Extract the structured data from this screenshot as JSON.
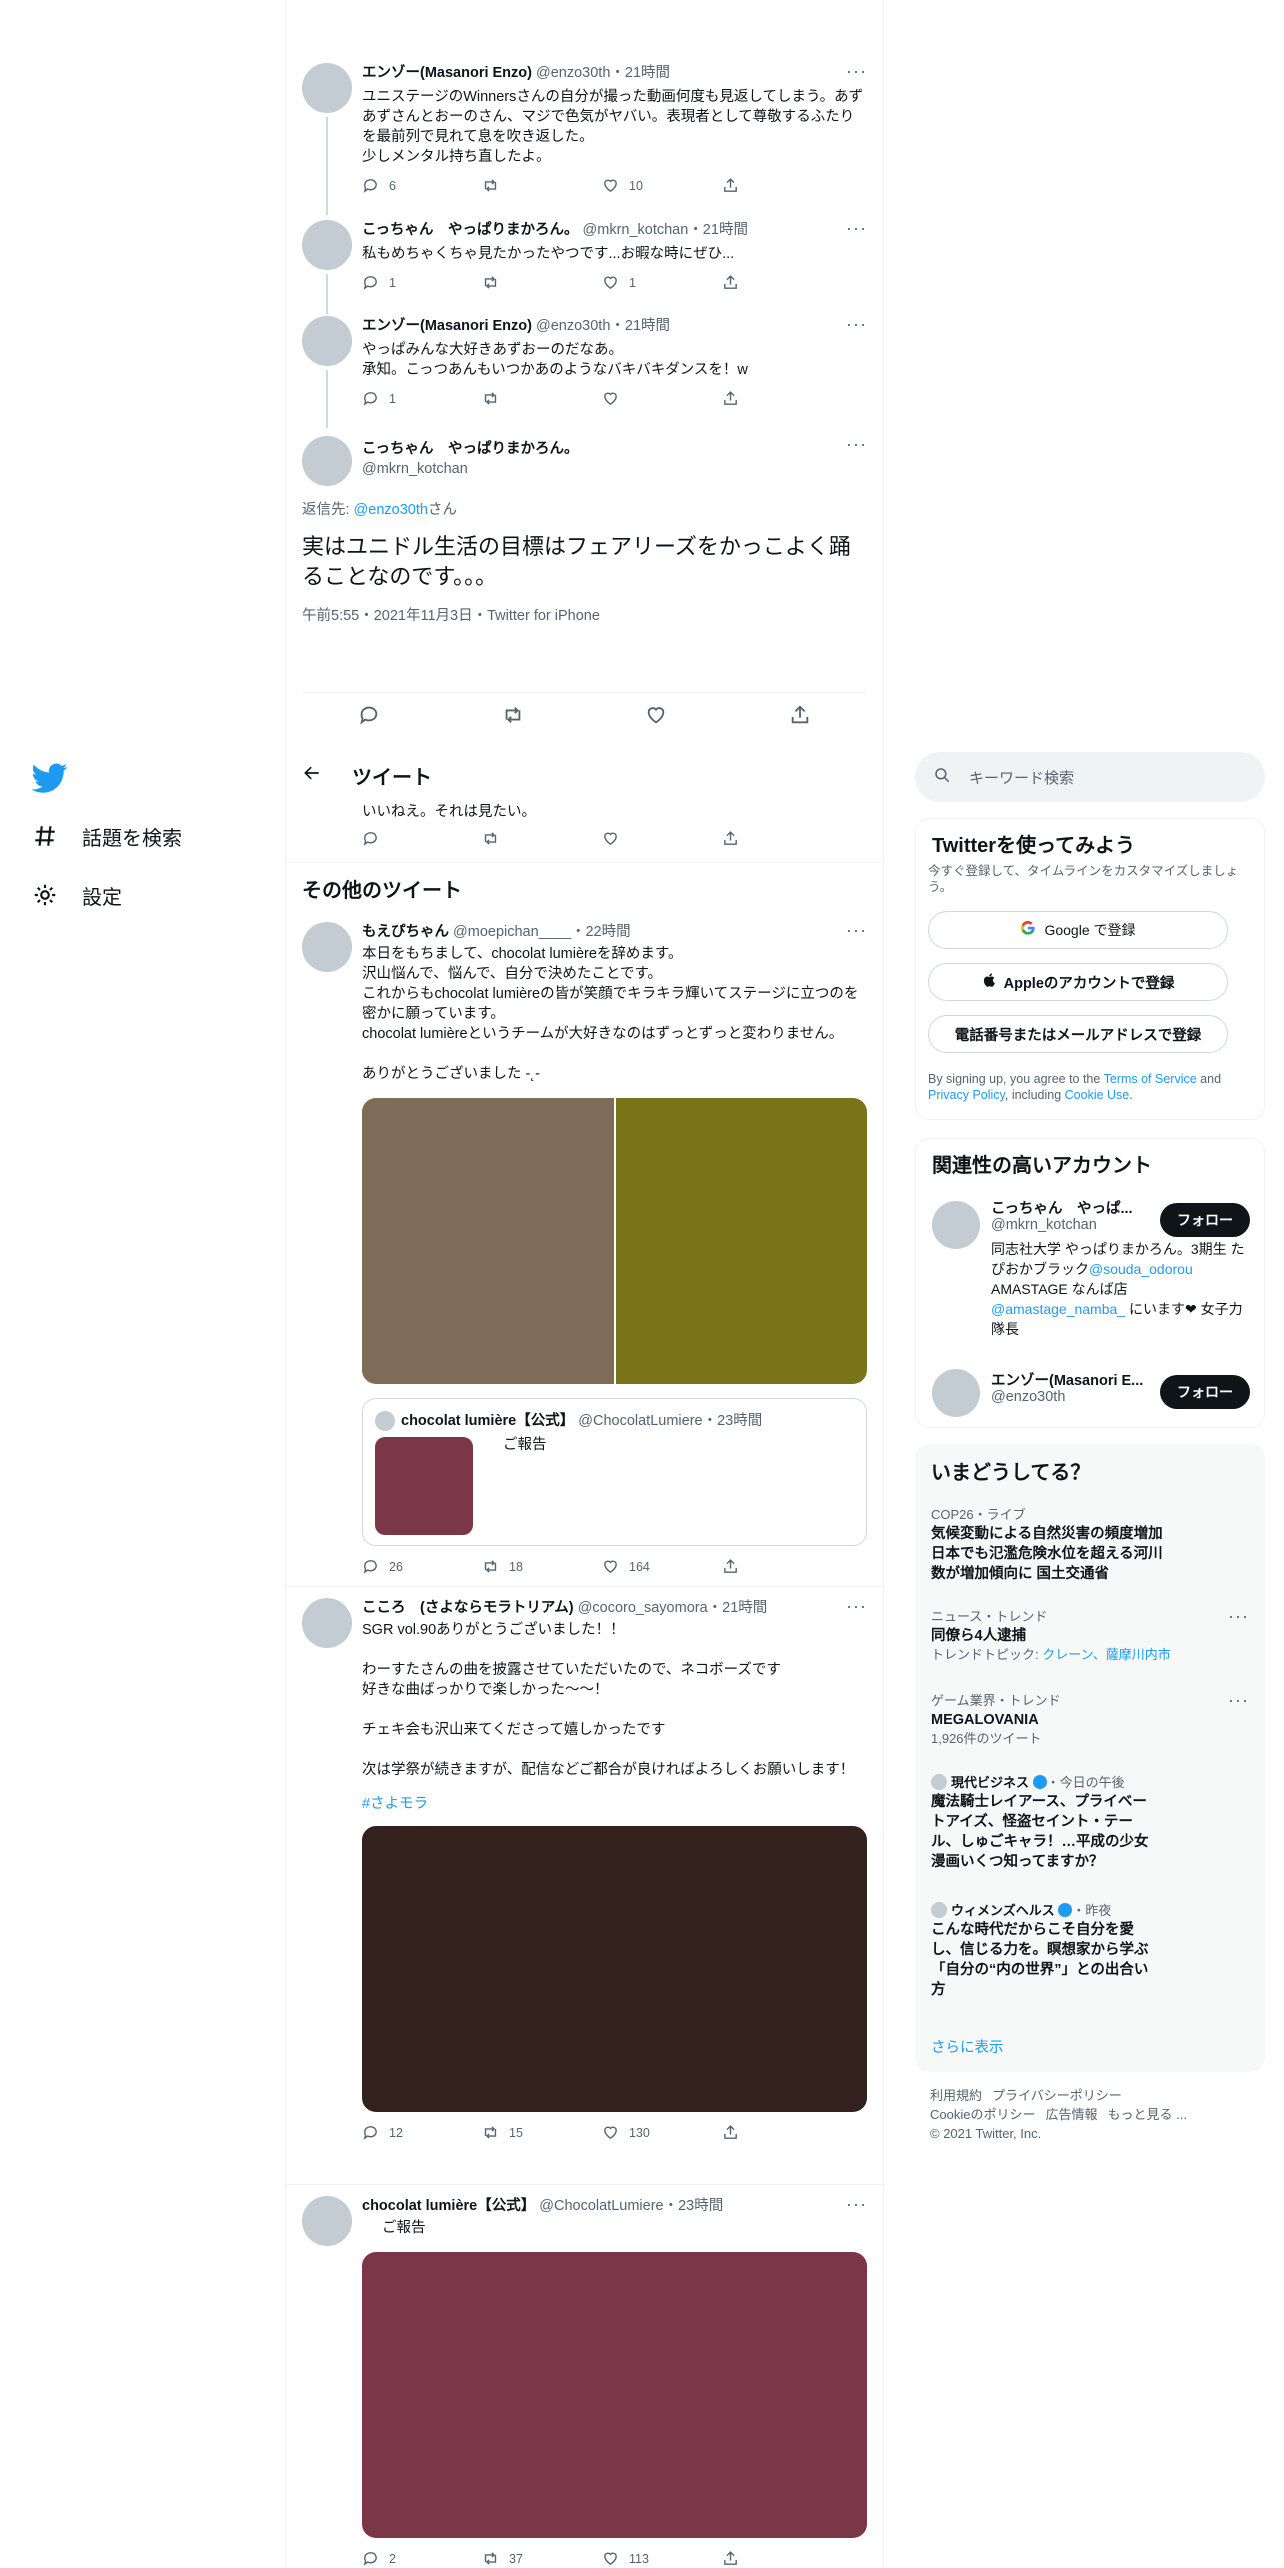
{
  "nav": {
    "explore": "話題を検索",
    "settings": "設定"
  },
  "thread": [
    {
      "name": "エンゾー(Masanori Enzo)",
      "handle": "@enzo30th",
      "time": "・21時間",
      "text": "ユニステージのWinnersさんの自分が撮った動画何度も見返してしまう。あずあずさんとおーのさん、マジで色気がヤバい。表現者として尊敬するふたりを最前列で見れて息を吹き返した。\n少しメンタル持ち直したよ。",
      "reply": "6",
      "retweet": "",
      "like": "10"
    },
    {
      "name": "こっちゃん　やっぱりまかろん。",
      "handle": "@mkrn_kotchan",
      "time": "・21時間",
      "text": "私もめちゃくちゃ見たかったやつです...お暇な時にぜひ...",
      "reply": "1",
      "retweet": "",
      "like": "1"
    },
    {
      "name": "エンゾー(Masanori Enzo)",
      "handle": "@enzo30th",
      "time": "・21時間",
      "text": "やっぱみんな大好きあずおーのだなあ。\n承知。こっつあんもいつかあのようなバキバキダンスを！w",
      "reply": "1",
      "retweet": "",
      "like": ""
    }
  ],
  "focus": {
    "name": "こっちゃん　やっぱりまかろん。",
    "handle": "@mkrn_kotchan",
    "reply_prefix": "返信先: ",
    "reply_to": "@enzo30th",
    "reply_suffix": "さん",
    "text": "実はユニドル生活の目標はフェアリーズをかっこよく踊ることなのです。。。",
    "meta": "午前5:55・2021年11月3日・Twitter for iPhone"
  },
  "header": {
    "title": "ツイート",
    "partial_text": "いいねえ。それは見たい。"
  },
  "more_tweets_title": "その他のツイート",
  "tweets": [
    {
      "name": "もえぴちゃん",
      "handle": "@moepichan____",
      "time": "・22時間",
      "text": "本日をもちまして、chocolat lumièreを辞めます。\n沢山悩んで、悩んで、自分で決めたことです。\nこれからもchocolat lumièreの皆が笑顔でキラキラ輝いてステージに立つのを密かに願っています。\nchocolat lumièreというチームが大好きなのはずっとずっと変わりません。\n\nありがとうございました -˛-",
      "image_colors": [
        "#7e6b58",
        "#7a7418"
      ],
      "quote": {
        "name": "chocolat lumière【公式】",
        "handle": "@ChocolatLumiere",
        "time": "・23時間",
        "text": "ご報告",
        "image_color": "#7b3748"
      },
      "reply": "26",
      "retweet": "18",
      "like": "164"
    },
    {
      "name": "こころ　(さよならモラトリアム)",
      "handle": "@cocoro_sayomora",
      "time": "・21時間",
      "text": "SGR vol.90ありがとうございました！！\n\nわーすたさんの曲を披露させていただいたので、ネコボーズです\n好きな曲ばっかりで楽しかった〜〜！\n\nチェキ会も沢山来てくださって嬉しかったです\n\n次は学祭が続きますが、配信などご都合が良ければよろしくお願いします！",
      "hashtag": "#さよモラ",
      "image_color": "#33211e",
      "reply": "12",
      "retweet": "15",
      "like": "130"
    },
    {
      "name": "chocolat lumière【公式】",
      "handle": "@ChocolatLumiere",
      "time": "・23時間",
      "text": "ご報告",
      "image_color": "#7b3748",
      "reply": "2",
      "retweet": "37",
      "like": "113"
    }
  ],
  "search": {
    "placeholder": "キーワード検索"
  },
  "signup": {
    "title": "Twitterを使ってみよう",
    "subtitle": "今すぐ登録して、タイムラインをカスタマイズしましょう。",
    "google": "Google で登録",
    "apple": "Appleのアカウントで登録",
    "phone": "電話番号またはメールアドレスで登録",
    "terms_1": "By signing up, you agree to the ",
    "terms_link1": "Terms of Service",
    "terms_2": " and ",
    "terms_link2": "Privacy Policy",
    "terms_3": ", including ",
    "terms_link3": "Cookie Use",
    "terms_4": "."
  },
  "related": {
    "title": "関連性の高いアカウント",
    "accounts": [
      {
        "name": "こっちゃん　やっぱ...",
        "handle": "@mkrn_kotchan",
        "bio_1": "同志社大学 やっぱりまかろん。3期生 たぴおかブラック",
        "bio_link1": "@souda_odorou",
        "bio_2": "　AMASTAGE なんば店 ",
        "bio_link2": "@amastage_namba_",
        "bio_3": " にいます❤︎ 女子力隊長",
        "follow": "フォロー"
      },
      {
        "name": "エンゾー(Masanori E...",
        "handle": "@enzo30th",
        "follow": "フォロー"
      }
    ]
  },
  "trends": {
    "title": "いまどうしてる？",
    "items": [
      {
        "meta": "COP26・ライブ",
        "title": "気候変動による自然災害の頻度増加 日本でも氾濫危険水位を超える河川数が増加傾向に 国土交通省"
      },
      {
        "meta": "ニュース・トレンド",
        "title": "同僚ら4人逮捕",
        "sub_prefix": "トレンドトピック: ",
        "sub_links": "クレーン、薩摩川内市"
      },
      {
        "meta": "ゲーム業界・トレンド",
        "title": "MEGALOVANIA",
        "sub": "1,926件のツイート"
      },
      {
        "source": "現代ビジネス",
        "when": "・今日の午後",
        "title": "魔法騎士レイアース、プライベートアイズ、怪盗セイント・テール、しゅごキャラ！…平成の少女漫画いくつ知ってますか？"
      },
      {
        "source": "ウィメンズヘルス",
        "when": "・昨夜",
        "title": "こんな時代だからこそ自分を愛し、信じる力を。瞑想家から学ぶ「自分の“内の世界”」との出合い方"
      }
    ],
    "more": "さらに表示"
  },
  "footer": {
    "links": [
      "利用規約",
      "プライバシーポリシー",
      "Cookieのポリシー",
      "広告情報",
      "もっと見る ..."
    ],
    "copyright": "© 2021 Twitter, Inc."
  },
  "colors": {
    "accent": "#1d9bf0",
    "text": "#0f1419",
    "secondary": "#536471"
  }
}
